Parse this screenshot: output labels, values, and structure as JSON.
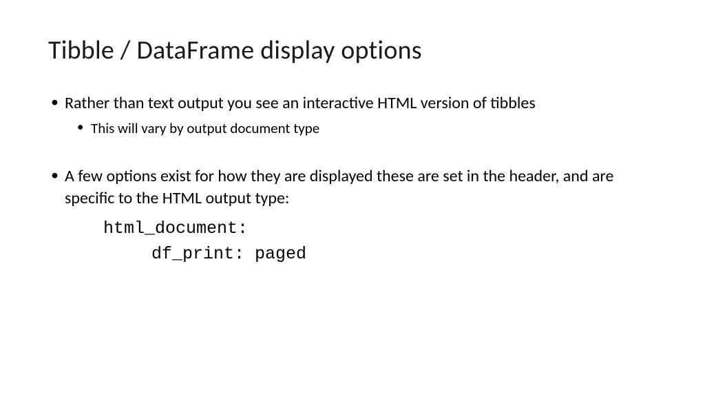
{
  "slide": {
    "title": "Tibble / DataFrame display options",
    "bullet1": "Rather than text output you see an interactive HTML version of tibbles",
    "bullet1_sub": "This will vary by output document type",
    "bullet2": "A few options exist for how they are displayed these are set in the header, and are specific to the HTML output type:",
    "code_line1": "html_document:",
    "code_line2": "df_print: paged"
  }
}
